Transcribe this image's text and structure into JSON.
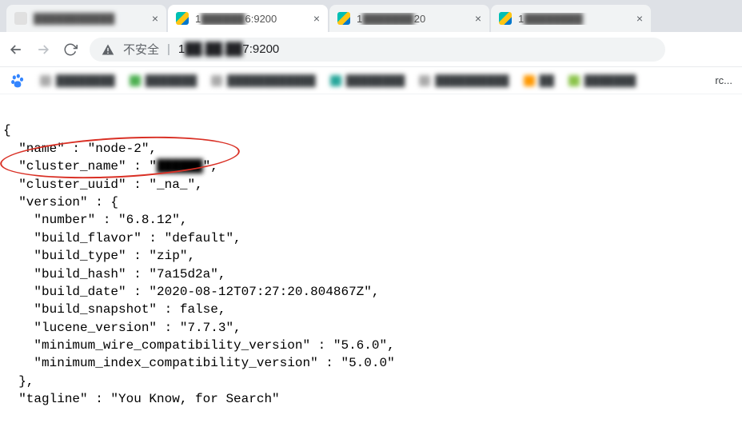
{
  "tabs": {
    "t0_title": "███████████",
    "t1_prefix": "1",
    "t1_suffix": "6:9200",
    "t2_prefix": "1",
    "t2_suffix": "20",
    "t3_prefix": "1",
    "t3_suffix": ""
  },
  "address": {
    "not_secure": "不安全",
    "url_prefix": "1",
    "url_suffix": "7:9200"
  },
  "bookmarks": {
    "overflow": "rc..."
  },
  "response": {
    "open_brace": "{",
    "name_line": "  \"name\" : \"node-2\",",
    "cluster_name_label": "  \"cluster_name\" : \"",
    "cluster_name_end": "\",",
    "cluster_uuid_line": "  \"cluster_uuid\" : \"_na_\",",
    "version_open": "  \"version\" : {",
    "number": "    \"number\" : \"6.8.12\",",
    "build_flavor": "    \"build_flavor\" : \"default\",",
    "build_type": "    \"build_type\" : \"zip\",",
    "build_hash": "    \"build_hash\" : \"7a15d2a\",",
    "build_date": "    \"build_date\" : \"2020-08-12T07:27:20.804867Z\",",
    "build_snapshot": "    \"build_snapshot\" : false,",
    "lucene_version": "    \"lucene_version\" : \"7.7.3\",",
    "min_wire": "    \"minimum_wire_compatibility_version\" : \"5.6.0\",",
    "min_index": "    \"minimum_index_compatibility_version\" : \"5.0.0\"",
    "version_close": "  },",
    "tagline": "  \"tagline\" : \"You Know, for Search\"",
    "close_brace": ""
  }
}
